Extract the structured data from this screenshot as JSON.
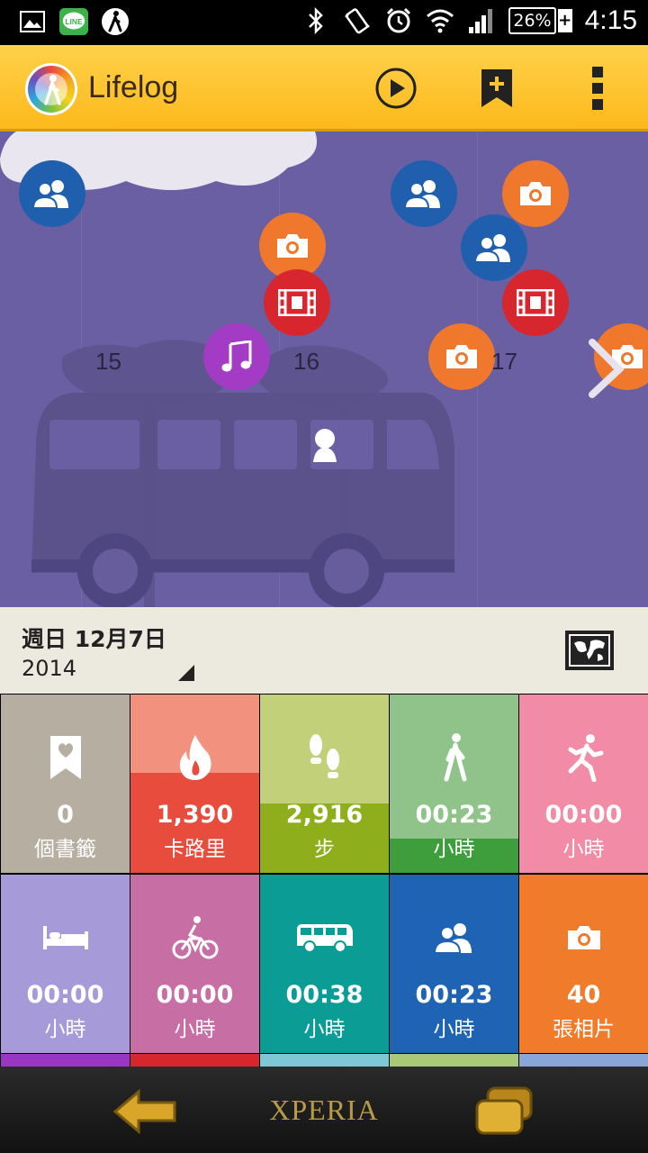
{
  "status_bar": {
    "battery_percent": "26%",
    "time": "4:15",
    "icons": [
      "gallery-icon",
      "line-app-icon",
      "walk-icon",
      "bluetooth-icon",
      "vibrate-icon",
      "alarm-icon",
      "wifi-icon",
      "signal-icon",
      "battery-icon"
    ],
    "line_label": "LINE"
  },
  "app_bar": {
    "title": "Lifelog",
    "actions": [
      "play-icon",
      "bookmark-add-icon",
      "overflow-menu-icon"
    ]
  },
  "timeline": {
    "days": [
      "15",
      "16",
      "17"
    ],
    "events": [
      "people",
      "camera",
      "film",
      "music",
      "people",
      "people",
      "camera",
      "film",
      "camera",
      "camera"
    ]
  },
  "date": {
    "day_date": "週日 12月7日",
    "year": "2014"
  },
  "tiles": [
    {
      "id": "bookmarks",
      "icon": "bookmark-heart-icon",
      "value": "0",
      "unit": "個書籤",
      "color": "#b5aea1",
      "fill_color": "#b5aea1",
      "fill_fraction": 1.0
    },
    {
      "id": "calories",
      "icon": "flame-icon",
      "value": "1,390",
      "unit": "卡路里",
      "color": "#f2917e",
      "fill_color": "#e84c3d",
      "fill_fraction": 0.56
    },
    {
      "id": "steps",
      "icon": "footsteps-icon",
      "value": "2,916",
      "unit": "步",
      "color": "#c2d07a",
      "fill_color": "#8fae1b",
      "fill_fraction": 0.39
    },
    {
      "id": "walking",
      "icon": "walk-icon",
      "value": "00:23",
      "unit": "小時",
      "color": "#8fc38a",
      "fill_color": "#3f9e3c",
      "fill_fraction": 0.19
    },
    {
      "id": "running",
      "icon": "run-icon",
      "value": "00:00",
      "unit": "小時",
      "color": "#f28ca6",
      "fill_color": "#f28ca6",
      "fill_fraction": 0.0
    },
    {
      "id": "sleep",
      "icon": "bed-icon",
      "value": "00:00",
      "unit": "小時",
      "color": "#a69ad8",
      "fill_color": "#a69ad8",
      "fill_fraction": 0.0
    },
    {
      "id": "cycling",
      "icon": "bike-icon",
      "value": "00:00",
      "unit": "小時",
      "color": "#c76fa5",
      "fill_color": "#c76fa5",
      "fill_fraction": 0.0
    },
    {
      "id": "transport",
      "icon": "bus-icon",
      "value": "00:38",
      "unit": "小時",
      "color": "#0b9c96",
      "fill_color": "#0b9c96",
      "fill_fraction": 1.0
    },
    {
      "id": "social",
      "icon": "people-icon",
      "value": "00:23",
      "unit": "小時",
      "color": "#1f63b4",
      "fill_color": "#1f63b4",
      "fill_fraction": 1.0
    },
    {
      "id": "photos",
      "icon": "camera-icon",
      "value": "40",
      "unit": "張相片",
      "color": "#f07b2b",
      "fill_color": "#f07b2b",
      "fill_fraction": 1.0
    }
  ],
  "bottom_strip_colors": [
    "#9a35c4",
    "#d8262f",
    "#7fc7d6",
    "#a9c978",
    "#8aa6d8"
  ],
  "nav_bar": {
    "brand": "XPERIA",
    "buttons": [
      "back-icon",
      "recent-apps-icon"
    ]
  }
}
